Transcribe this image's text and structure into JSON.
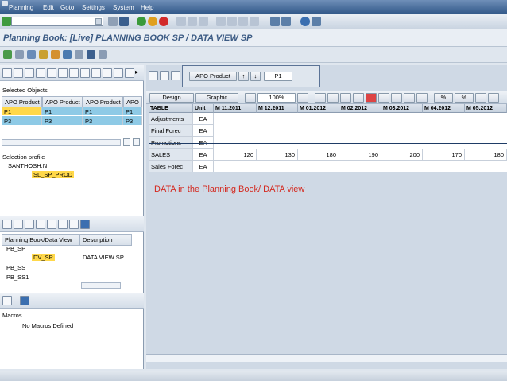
{
  "menu": {
    "items": [
      "Planning",
      "Edit",
      "Goto",
      "Settings",
      "System",
      "Help"
    ]
  },
  "window": {
    "title": "Planning Book: [Live] PLANNING BOOK SP / DATA VIEW SP"
  },
  "colors": {
    "menu_bg": "#2f5687",
    "title_text": "#3c5b84",
    "selected_row": "#8ecae6",
    "highlight": "#ffd84a",
    "note_text": "#d4281e"
  },
  "selected_objects": {
    "label": "Selected Objects",
    "columns": [
      "APO Product",
      "APO Product",
      "APO Product",
      "APO P"
    ],
    "rows": [
      [
        "P1",
        "P1",
        "P1",
        "P1"
      ],
      [
        "P3",
        "P3",
        "P3",
        "P3"
      ]
    ]
  },
  "selection_profile": {
    "label": "Selection profile",
    "user": "SANTHOSH.N",
    "selection": "SL_SP_PROD"
  },
  "planning_books": {
    "columns": [
      "Planning Book/Data View",
      "Description"
    ],
    "items": [
      {
        "name": "PB_SP",
        "desc": ""
      },
      {
        "name": "DV_SP",
        "desc": "DATA VIEW SP"
      },
      {
        "name": "PB_SS",
        "desc": ""
      },
      {
        "name": "PB_SS1",
        "desc": ""
      }
    ]
  },
  "macros": {
    "label": "Macros",
    "empty": "No Macros Defined"
  },
  "header_area": {
    "product_btn": "APO Product",
    "product_value": "P1"
  },
  "grid_toolbar": {
    "design": "Design",
    "graphic": "Graphic",
    "zoom": "100%",
    "pct1": "%",
    "pct2": "%"
  },
  "grid": {
    "columns": [
      "TABLE",
      "Unit",
      "M 11.2011",
      "M 12.2011",
      "M 01.2012",
      "M 02.2012",
      "M 03.2012",
      "M 04.2012",
      "M 05.2012"
    ],
    "rows": [
      {
        "label": "Adjustments",
        "unit": "EA",
        "values": [
          "",
          "",
          "",
          "",
          "",
          "",
          ""
        ]
      },
      {
        "label": "Final Forec",
        "unit": "EA",
        "values": [
          "",
          "",
          "",
          "",
          "",
          "",
          ""
        ]
      },
      {
        "label": "Promotions",
        "unit": "EA",
        "values": [
          "",
          "",
          "",
          "",
          "",
          "",
          ""
        ]
      },
      {
        "label": "SALES",
        "unit": "EA",
        "values": [
          "120",
          "130",
          "180",
          "190",
          "200",
          "170",
          "180"
        ]
      },
      {
        "label": "Sales Forec",
        "unit": "EA",
        "values": [
          "",
          "",
          "",
          "",
          "",
          "",
          ""
        ]
      }
    ]
  },
  "annotation": "DATA in the Planning Book/ DATA view"
}
